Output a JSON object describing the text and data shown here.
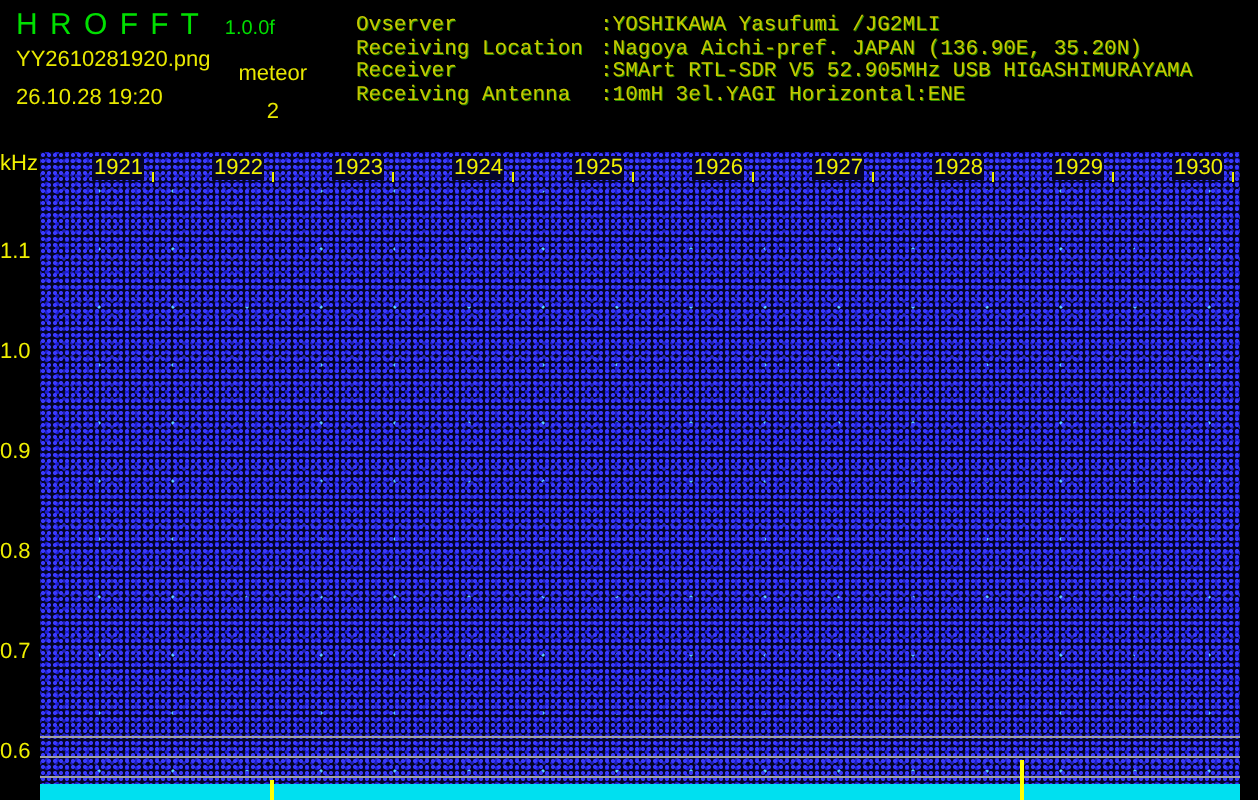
{
  "app": {
    "title": "H R O F F T",
    "version": "1.0.0f",
    "file_name": "YY2610281920.png",
    "timestamp": "26.10.28 19:20",
    "count_label": "meteor",
    "count": "2"
  },
  "station_info": [
    {
      "label": "Ovserver",
      "value": ":YOSHIKAWA Yasufumi /JG2MLI"
    },
    {
      "label": "Receiving Location",
      "value": ":Nagoya Aichi-pref. JAPAN (136.90E, 35.20N)"
    },
    {
      "label": "Receiver",
      "value": ":SMArt RTL-SDR V5 52.905MHz USB HIGASHIMURAYAMA"
    },
    {
      "label": "Receiving Antenna",
      "value": ":10mH 3el.YAGI Horizontal:ENE"
    }
  ],
  "spectrogram": {
    "unit": "kHz",
    "time_labels": [
      "1921",
      "1922",
      "1923",
      "1924",
      "1925",
      "1926",
      "1927",
      "1928",
      "1929",
      "1930"
    ],
    "frequency_labels": [
      "1.1",
      "1.0",
      "0.9",
      "0.8",
      "0.7",
      "0.6"
    ]
  }
}
